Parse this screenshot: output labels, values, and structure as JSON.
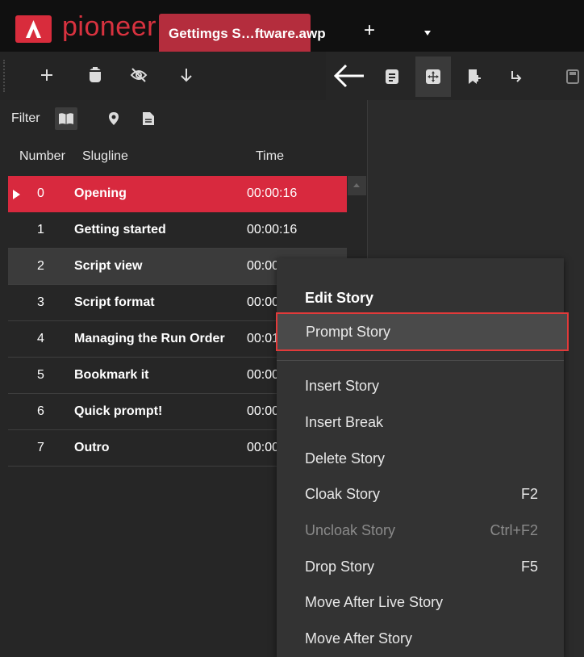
{
  "titlebar": {
    "brand": "pioneer",
    "document_tab": "Gettimgs S…ftware.awp",
    "new_tab": "+"
  },
  "filter": {
    "label": "Filter"
  },
  "columns": {
    "number": "Number",
    "slugline": "Slugline",
    "time": "Time"
  },
  "stories": [
    {
      "number": "0",
      "slugline": "Opening",
      "time": "00:00:16"
    },
    {
      "number": "1",
      "slugline": "Getting started",
      "time": "00:00:16"
    },
    {
      "number": "2",
      "slugline": "Script view",
      "time": "00:00"
    },
    {
      "number": "3",
      "slugline": "Script format",
      "time": "00:00"
    },
    {
      "number": "4",
      "slugline": "Managing the Run Order",
      "time": "00:01"
    },
    {
      "number": "5",
      "slugline": "Bookmark it",
      "time": "00:00"
    },
    {
      "number": "6",
      "slugline": "Quick prompt!",
      "time": "00:00"
    },
    {
      "number": "7",
      "slugline": "Outro",
      "time": "00:00"
    }
  ],
  "context_menu": {
    "header": "Edit Story",
    "items": [
      {
        "label": "Prompt Story",
        "shortcut": ""
      },
      {
        "label": "Insert Story",
        "shortcut": ""
      },
      {
        "label": "Insert Break",
        "shortcut": ""
      },
      {
        "label": "Delete Story",
        "shortcut": ""
      },
      {
        "label": "Cloak Story",
        "shortcut": "F2"
      },
      {
        "label": "Uncloak Story",
        "shortcut": "Ctrl+F2"
      },
      {
        "label": "Drop Story",
        "shortcut": "F5"
      },
      {
        "label": "Move After Live Story",
        "shortcut": ""
      },
      {
        "label": "Move After Story",
        "shortcut": ""
      }
    ]
  },
  "colors": {
    "accent": "#d8293e",
    "tab": "#b42d3d",
    "highlight_outline": "#e23a3a"
  }
}
